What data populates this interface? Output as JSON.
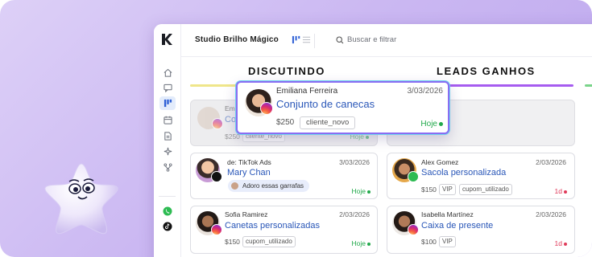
{
  "app": {
    "workspace": "Studio Brilho Mágico",
    "search_placeholder": "Buscar e filtrar"
  },
  "sidebar": {
    "icons": [
      "home-icon",
      "chat-icon",
      "board-icon",
      "calendar-icon",
      "document-icon",
      "sparkle-icon",
      "flow-icon",
      "whatsapp-icon",
      "tiktok-icon"
    ],
    "active": "board-icon"
  },
  "columns": [
    {
      "title": "DISCUTINDO",
      "accent": "#efe68a"
    },
    {
      "title": "LEADS GANHOS",
      "accent": "#a65cf0"
    }
  ],
  "dragging_card": {
    "name": "Emiliana Ferreira",
    "date": "3/03/2026",
    "title": "Conjunto de canecas",
    "price": "$250",
    "tag": "cliente_novo",
    "status": "Hoje",
    "channel": "instagram"
  },
  "ghost_card": {
    "name": "Em",
    "title": "Co",
    "price": "$250",
    "tag": "cliente_novo",
    "status": "Hoje"
  },
  "discutindo_cards": [
    {
      "name": "de: TikTok Ads",
      "date": "3/03/2026",
      "title": "Mary Chan",
      "note": "Adoro essas garrafas",
      "status": "Hoje",
      "channel": "tiktok"
    },
    {
      "name": "Sofia Ramirez",
      "date": "2/03/2026",
      "title": "Canetas personalizadas",
      "price": "$150",
      "tags": [
        "cupom_utilizado"
      ],
      "status": "Hoje",
      "channel": "instagram"
    }
  ],
  "ganhos_cards": [
    {
      "name": "Alex Gomez",
      "date": "2/03/2026",
      "title": "Sacola personalizada",
      "price": "$150",
      "tags": [
        "VIP",
        "cupom_utilizado"
      ],
      "status": "1d",
      "channel": "whatsapp"
    },
    {
      "name": "Isabella Martínez",
      "date": "2/03/2026",
      "title": "Caixa de presente",
      "price": "$100",
      "tags": [
        "VIP"
      ],
      "status": "1d",
      "channel": "instagram"
    }
  ],
  "colors": {
    "link": "#2a57b8",
    "today": "#22a94b",
    "overdue": "#e03a5a",
    "background": "#cbb8f2"
  }
}
